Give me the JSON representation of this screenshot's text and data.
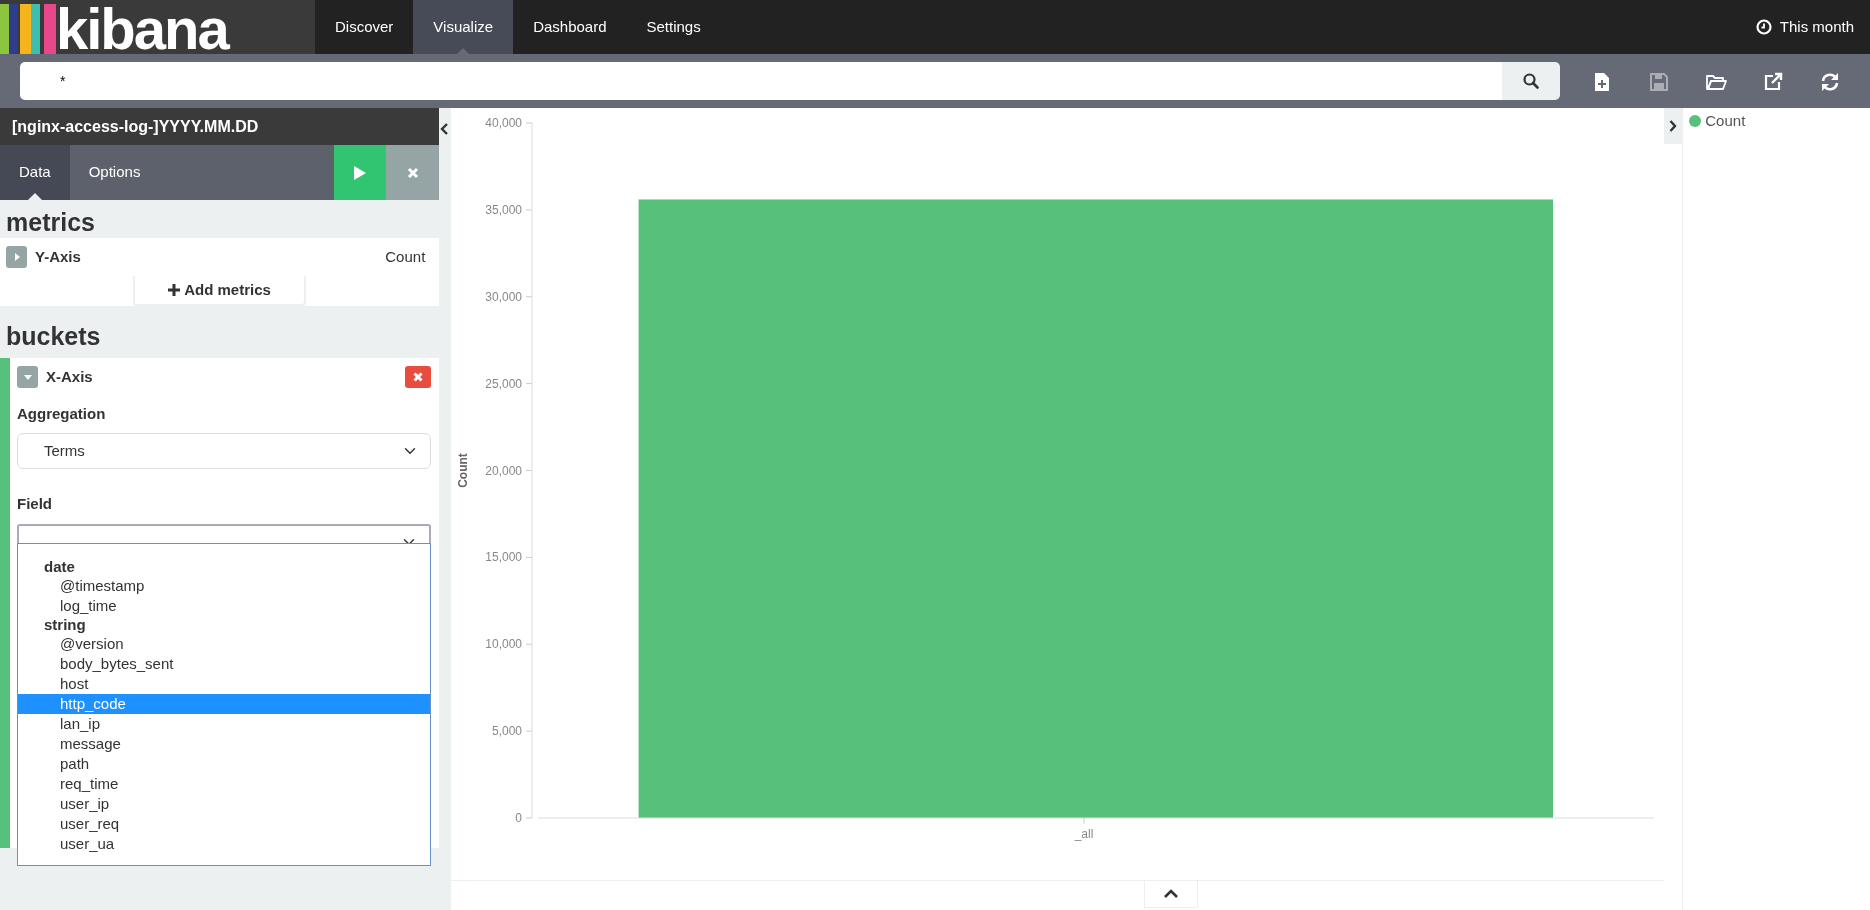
{
  "navbar": {
    "logo": "kibana",
    "tabs": [
      {
        "label": "Discover",
        "selected": false
      },
      {
        "label": "Visualize",
        "selected": true
      },
      {
        "label": "Dashboard",
        "selected": false
      },
      {
        "label": "Settings",
        "selected": false
      }
    ],
    "time_range": "This month"
  },
  "query": {
    "value": "*"
  },
  "toolbar": [
    {
      "kind": "new",
      "disabled": false
    },
    {
      "kind": "save",
      "disabled": true
    },
    {
      "kind": "open",
      "disabled": false
    },
    {
      "kind": "share",
      "disabled": false
    },
    {
      "kind": "refresh",
      "disabled": false
    }
  ],
  "editor": {
    "index_pattern": "[nginx-access-log-]YYYY.MM.DD",
    "tabs": [
      {
        "label": "Data",
        "selected": true
      },
      {
        "label": "Options",
        "selected": false
      }
    ],
    "metrics": {
      "heading": "metrics",
      "items": [
        {
          "label": "Y-Axis",
          "value": "Count",
          "expanded": false
        }
      ],
      "add_button": "Add metrics"
    },
    "buckets": {
      "heading": "buckets",
      "items": [
        {
          "label": "X-Axis",
          "expanded": true,
          "aggregation_label": "Aggregation",
          "aggregation": "Terms",
          "field_label": "Field",
          "field_dropdown": [
            {
              "group": "date",
              "options": [
                {
                  "label": "@timestamp",
                  "selected": false
                },
                {
                  "label": "log_time",
                  "selected": false
                }
              ]
            },
            {
              "group": "string",
              "options": [
                {
                  "label": "@version",
                  "selected": false
                },
                {
                  "label": "body_bytes_sent",
                  "selected": false
                },
                {
                  "label": "host",
                  "selected": false
                },
                {
                  "label": "http_code",
                  "selected": true
                },
                {
                  "label": "lan_ip",
                  "selected": false
                },
                {
                  "label": "message",
                  "selected": false
                },
                {
                  "label": "path",
                  "selected": false
                },
                {
                  "label": "req_time",
                  "selected": false
                },
                {
                  "label": "user_ip",
                  "selected": false
                },
                {
                  "label": "user_req",
                  "selected": false
                },
                {
                  "label": "user_ua",
                  "selected": false
                }
              ]
            }
          ]
        }
      ]
    }
  },
  "chart": {
    "chart_data": {
      "type": "bar",
      "ylabel": "Count",
      "categories": [
        "_all"
      ],
      "series": [
        {
          "name": "Count",
          "color": "#57c17b",
          "values": [
            35600
          ]
        }
      ],
      "ylim": [
        0,
        40000
      ],
      "legend": true,
      "yticks": [
        {
          "value": 0,
          "label": "0"
        },
        {
          "value": 5000,
          "label": "5,000"
        },
        {
          "value": 10000,
          "label": "10,000"
        },
        {
          "value": 15000,
          "label": "15,000"
        },
        {
          "value": 20000,
          "label": "20,000"
        },
        {
          "value": 25000,
          "label": "25,000"
        },
        {
          "value": 30000,
          "label": "30,000"
        },
        {
          "value": 35000,
          "label": "35,000"
        },
        {
          "value": 40000,
          "label": "40,000"
        }
      ]
    }
  }
}
